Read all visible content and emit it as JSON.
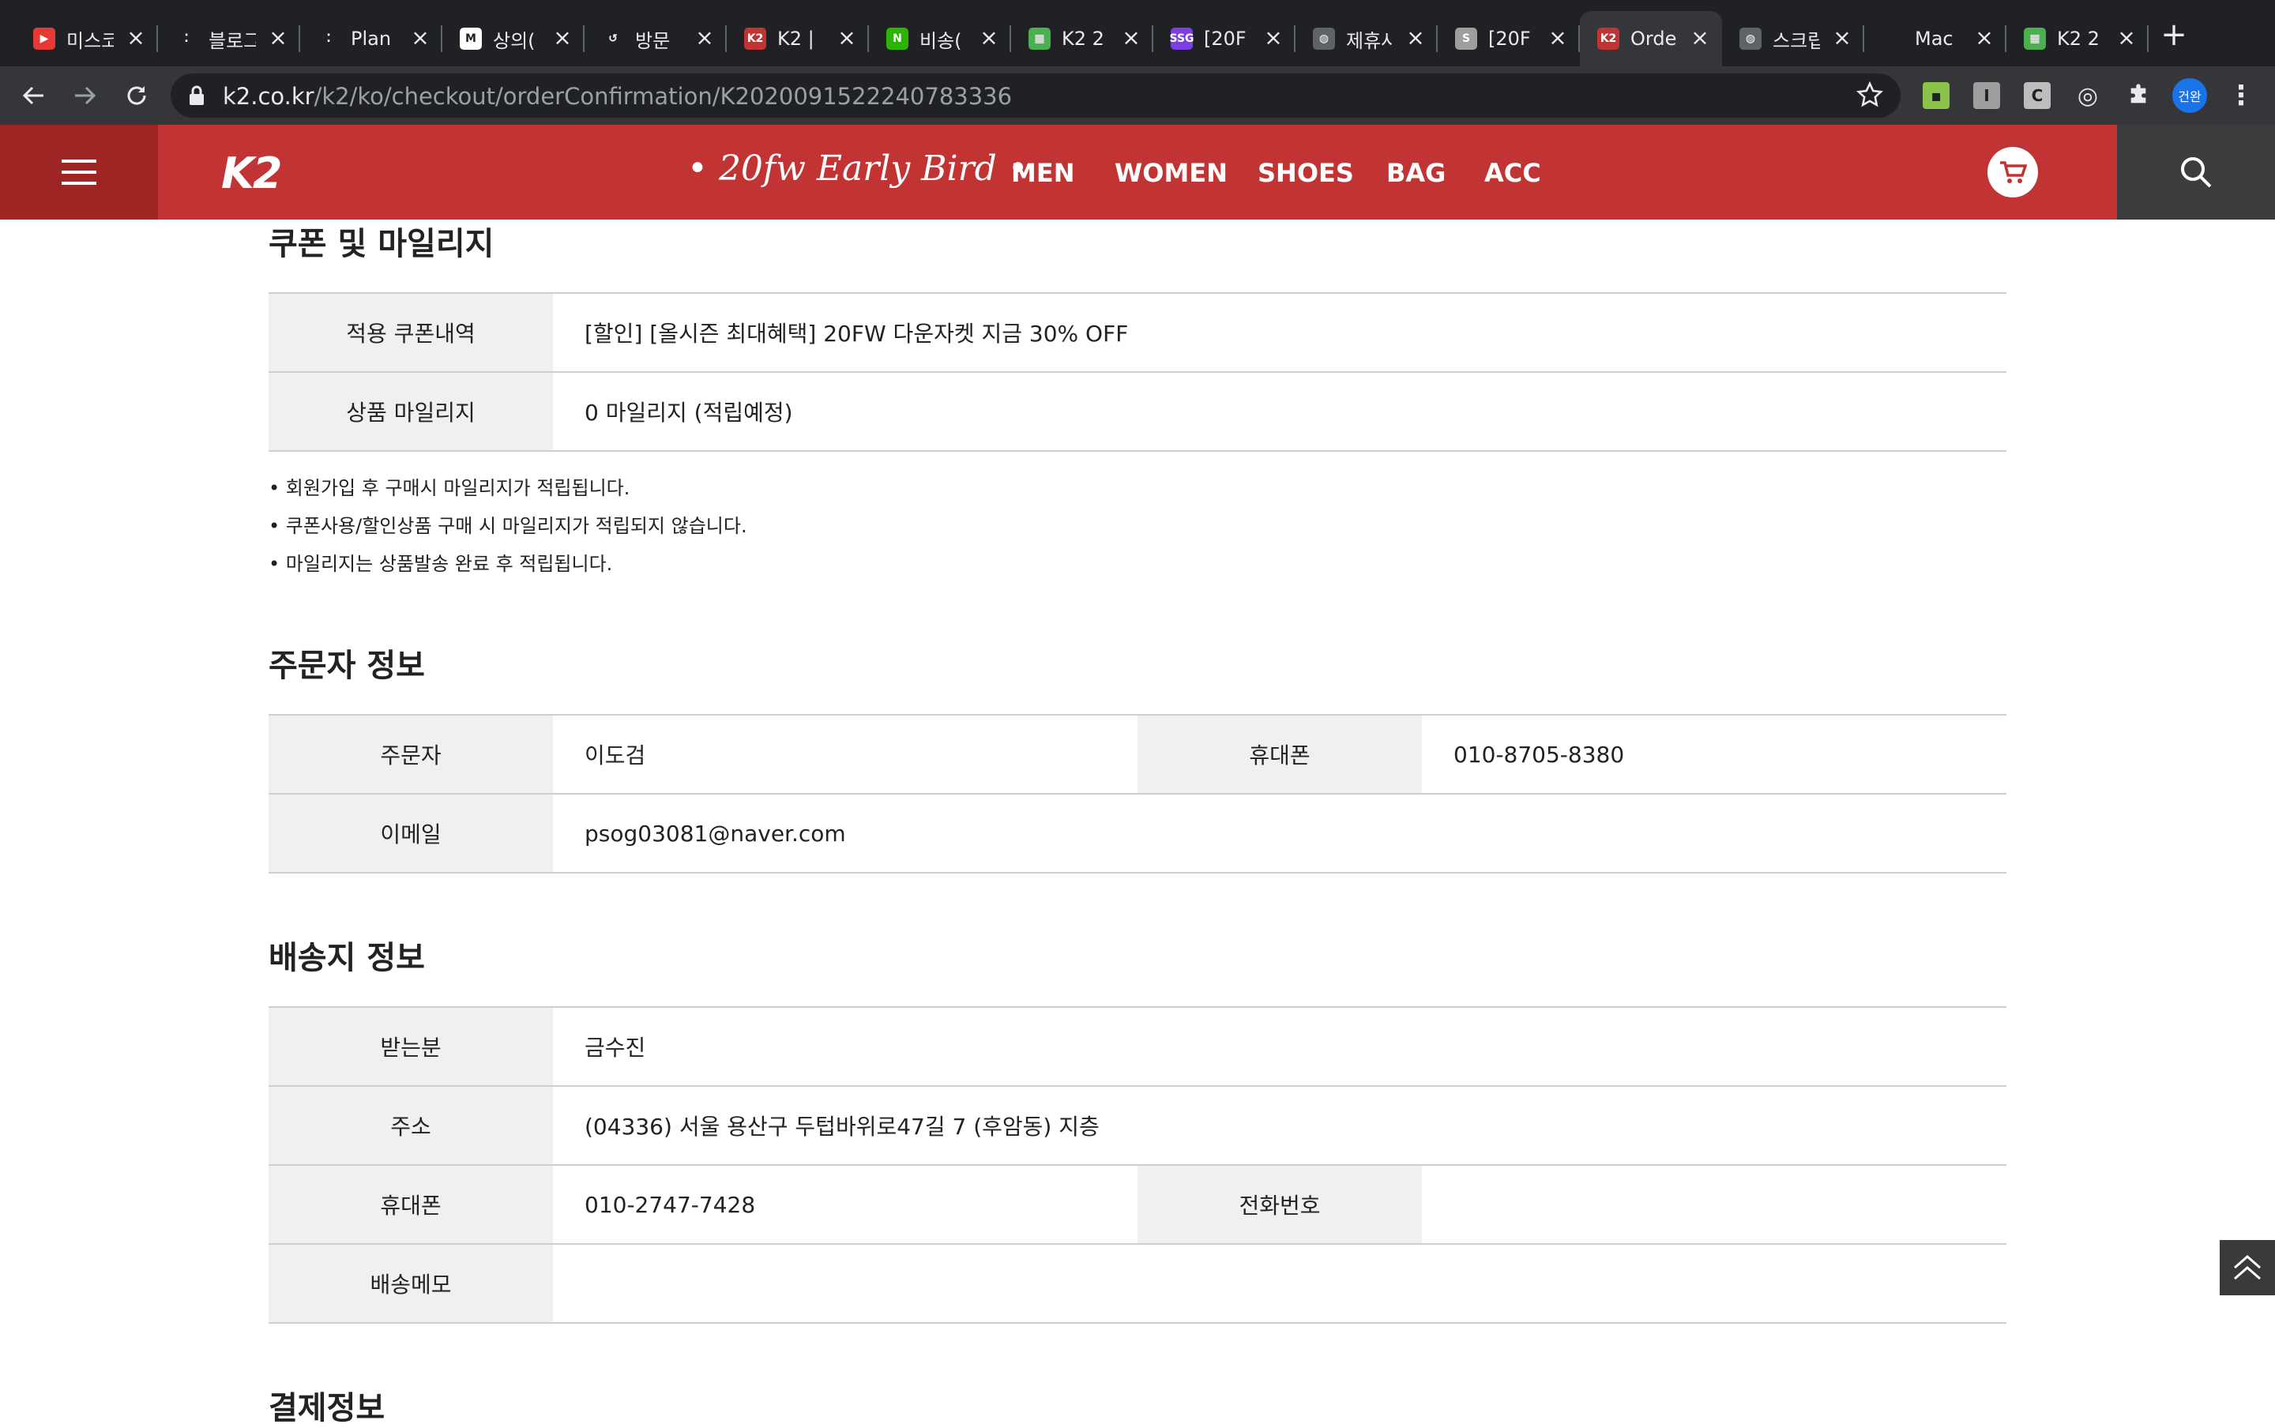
{
  "browser": {
    "tabs": [
      {
        "title": "미스코",
        "favicon_color": "#e53935",
        "favicon_text": "▶"
      },
      {
        "title": "블로그",
        "favicon_color": "#202124",
        "favicon_text": "⁚"
      },
      {
        "title": "Plan",
        "favicon_color": "#202124",
        "favicon_text": "⁚"
      },
      {
        "title": "상의(",
        "favicon_color": "#ffffff",
        "favicon_text": "M"
      },
      {
        "title": "방문",
        "favicon_color": "#202124",
        "favicon_text": "↺"
      },
      {
        "title": "K2 |",
        "favicon_color": "#c23434",
        "favicon_text": "K2"
      },
      {
        "title": "비송(",
        "favicon_color": "#2db400",
        "favicon_text": "N"
      },
      {
        "title": "K2 2",
        "favicon_color": "#4caf50",
        "favicon_text": "▦"
      },
      {
        "title": "[20F",
        "favicon_color": "#7b3fe4",
        "favicon_text": "SSG"
      },
      {
        "title": "제휴사",
        "favicon_color": "#5f6368",
        "favicon_text": "◍"
      },
      {
        "title": "[20F",
        "favicon_color": "#9e9e9e",
        "favicon_text": "S"
      },
      {
        "title": "Orde",
        "favicon_color": "#c23434",
        "favicon_text": "K2",
        "active": true
      },
      {
        "title": "스크립",
        "favicon_color": "#5f6368",
        "favicon_text": "◍"
      },
      {
        "title": "Mac",
        "favicon_color": "#202124",
        "favicon_text": ""
      },
      {
        "title": "K2 2",
        "favicon_color": "#4caf50",
        "favicon_text": "▦"
      }
    ],
    "url_domain": "k2.co.kr",
    "url_path": "/k2/ko/checkout/orderConfirmation/K202009152224078333​6",
    "profile_label": "건완"
  },
  "site": {
    "logo": "K2",
    "promo": "• 20fw Early Bird •",
    "nav": [
      "MEN",
      "WOMEN",
      "SHOES",
      "BAG",
      "ACC"
    ]
  },
  "coupon_section": {
    "title": "쿠폰 및 마일리지",
    "rows": [
      {
        "label": "적용 쿠폰내역",
        "value": "[할인] [올시즌 최대혜택] 20FW 다운자켓 지금 30% OFF"
      },
      {
        "label": "상품 마일리지",
        "value": "0 마일리지 (적립예정)"
      }
    ],
    "notes": [
      "회원가입 후 구매시 마일리지가 적립됩니다.",
      "쿠폰사용/할인상품 구매 시 마일리지가 적립되지 않습니다.",
      "마일리지는 상품발송 완료 후 적립됩니다."
    ]
  },
  "orderer_section": {
    "title": "주문자 정보",
    "name_label": "주문자",
    "name_value": "이도검",
    "phone_label": "휴대폰",
    "phone_value": "010-8705-8380",
    "email_label": "이메일",
    "email_value": "psog03081@naver.com"
  },
  "shipping_section": {
    "title": "배송지 정보",
    "recipient_label": "받는분",
    "recipient_value": "금수진",
    "address_label": "주소",
    "address_value": "(04336) 서울 용산구 두텁바위로47길 7 (후암동)  지층",
    "mobile_label": "휴대폰",
    "mobile_value": "010-2747-7428",
    "tel_label": "전화번호",
    "tel_value": "",
    "memo_label": "배송메모",
    "memo_value": ""
  },
  "payment_section": {
    "title": "결제정보"
  }
}
